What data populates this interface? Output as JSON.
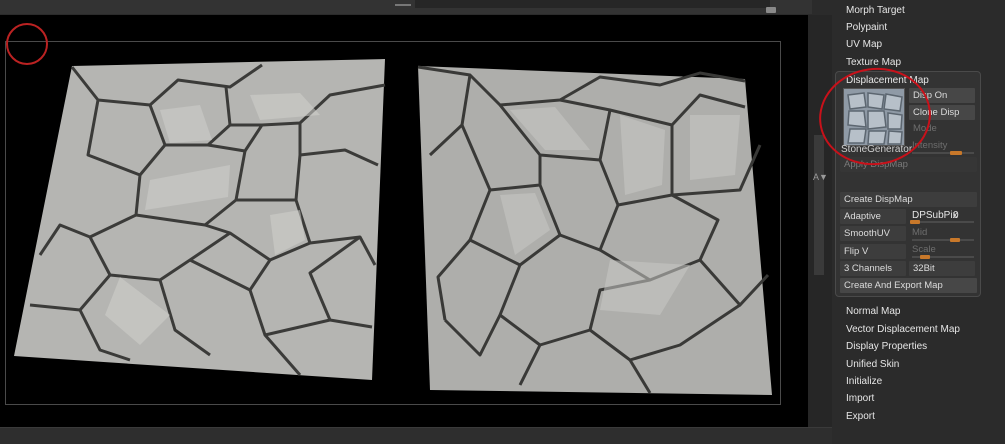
{
  "menu_top": [
    {
      "label": "Morph Target"
    },
    {
      "label": "Polypaint"
    },
    {
      "label": "UV Map"
    },
    {
      "label": "Texture Map"
    }
  ],
  "displacement_map": {
    "header": "Displacement Map",
    "disp_on": "Disp On",
    "clone_disp": "Clone Disp",
    "mode": "Mode",
    "thumbnail_name": "StoneGenerator",
    "intensity": "Intensity",
    "apply_dispmap": "Apply DispMap",
    "create_dispmap": "Create DispMap",
    "adaptive": "Adaptive",
    "dpsubpix_label": "DPSubPix",
    "dpsubpix_value": "0",
    "smoothuv": "SmoothUV",
    "mid": "Mid",
    "flip_v": "Flip V",
    "scale": "Scale",
    "channels": "3 Channels",
    "bit_depth": "32Bit",
    "create_export": "Create And Export Map"
  },
  "menu_bottom": [
    {
      "label": "Normal Map"
    },
    {
      "label": "Vector Displacement Map"
    },
    {
      "label": "Display Properties"
    },
    {
      "label": "Unified Skin"
    },
    {
      "label": "Initialize"
    },
    {
      "label": "Import"
    },
    {
      "label": "Export"
    }
  ],
  "scroll_marker": "A▼",
  "colors": {
    "accent": "#c8782a",
    "annotation": "#c8111a",
    "stone": "#b9b9b6",
    "crack": "#3a3a38"
  }
}
